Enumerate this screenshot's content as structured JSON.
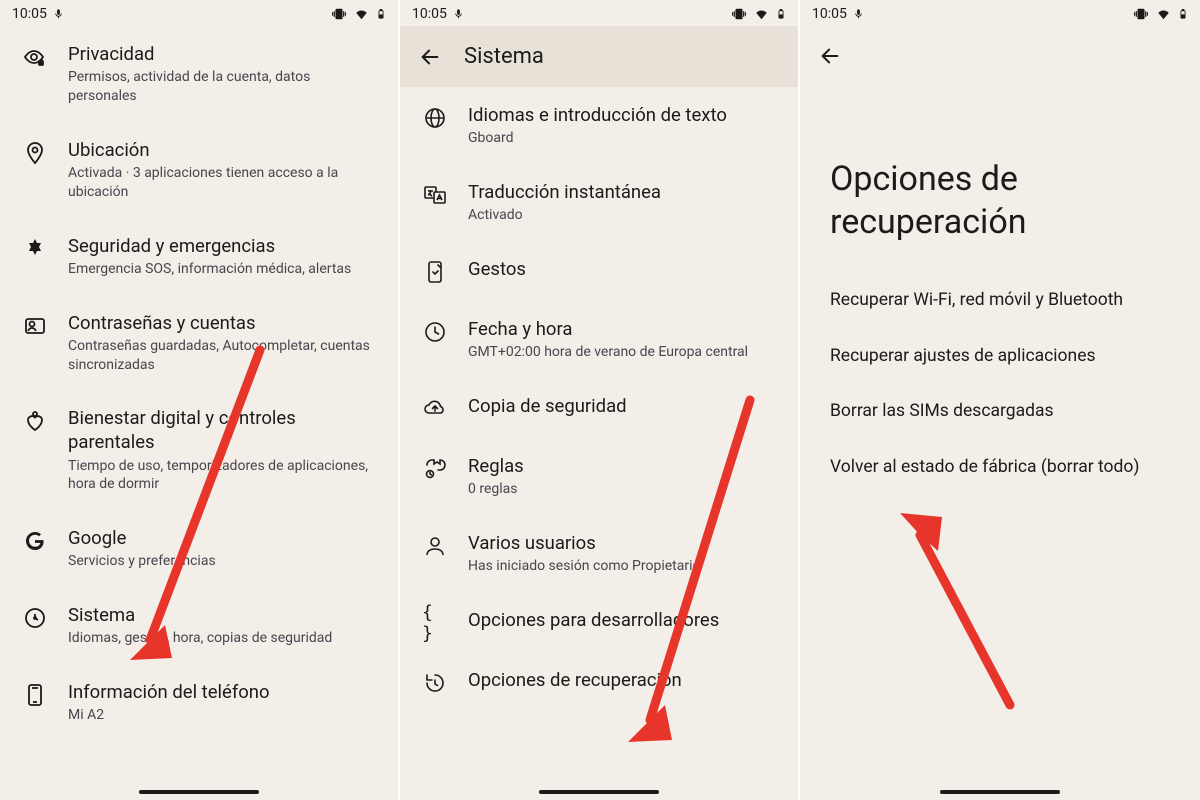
{
  "status": {
    "time": "10:05"
  },
  "panel1": {
    "items": [
      {
        "icon": "privacy-icon",
        "label": "Privacidad",
        "sub": "Permisos, actividad de la cuenta, datos personales"
      },
      {
        "icon": "location-icon",
        "label": "Ubicación",
        "sub": "Activada · 3 aplicaciones tienen acceso a la ubicación"
      },
      {
        "icon": "emergency-icon",
        "label": "Seguridad y emergencias",
        "sub": "Emergencia SOS, información médica, alertas"
      },
      {
        "icon": "passwords-icon",
        "label": "Contraseñas y cuentas",
        "sub": "Contraseñas guardadas, Autocompletar, cuentas sincronizadas"
      },
      {
        "icon": "wellbeing-icon",
        "label": "Bienestar digital y controles parentales",
        "sub": "Tiempo de uso, temporizadores de aplicaciones, hora de dormir"
      },
      {
        "icon": "google-icon",
        "label": "Google",
        "sub": "Servicios y preferencias"
      },
      {
        "icon": "system-icon",
        "label": "Sistema",
        "sub": "Idiomas, gestos, hora, copias de seguridad"
      },
      {
        "icon": "about-phone-icon",
        "label": "Información del teléfono",
        "sub": "Mi A2"
      }
    ]
  },
  "panel2": {
    "title": "Sistema",
    "items": [
      {
        "icon": "language-icon",
        "label": "Idiomas e introducción de texto",
        "sub": "Gboard"
      },
      {
        "icon": "translate-icon",
        "label": "Traducción instantánea",
        "sub": "Activado"
      },
      {
        "icon": "gestures-icon",
        "label": "Gestos",
        "sub": ""
      },
      {
        "icon": "clock-icon",
        "label": "Fecha y hora",
        "sub": "GMT+02:00 hora de verano de Europa central"
      },
      {
        "icon": "backup-icon",
        "label": "Copia de seguridad",
        "sub": ""
      },
      {
        "icon": "rules-icon",
        "label": "Reglas",
        "sub": "0 reglas"
      },
      {
        "icon": "users-icon",
        "label": "Varios usuarios",
        "sub": "Has iniciado sesión como Propietario"
      },
      {
        "icon": "developer-icon",
        "label": "Opciones para desarrolladores",
        "sub": ""
      },
      {
        "icon": "reset-icon",
        "label": "Opciones de recuperación",
        "sub": ""
      }
    ]
  },
  "panel3": {
    "title": "Opciones de recuperación",
    "items": [
      "Recuperar Wi-Fi, red móvil y Bluetooth",
      "Recuperar ajustes de aplicaciones",
      "Borrar las SIMs descargadas",
      "Volver al estado de fábrica (borrar todo)"
    ]
  },
  "colors": {
    "arrow": "#e7352c"
  }
}
